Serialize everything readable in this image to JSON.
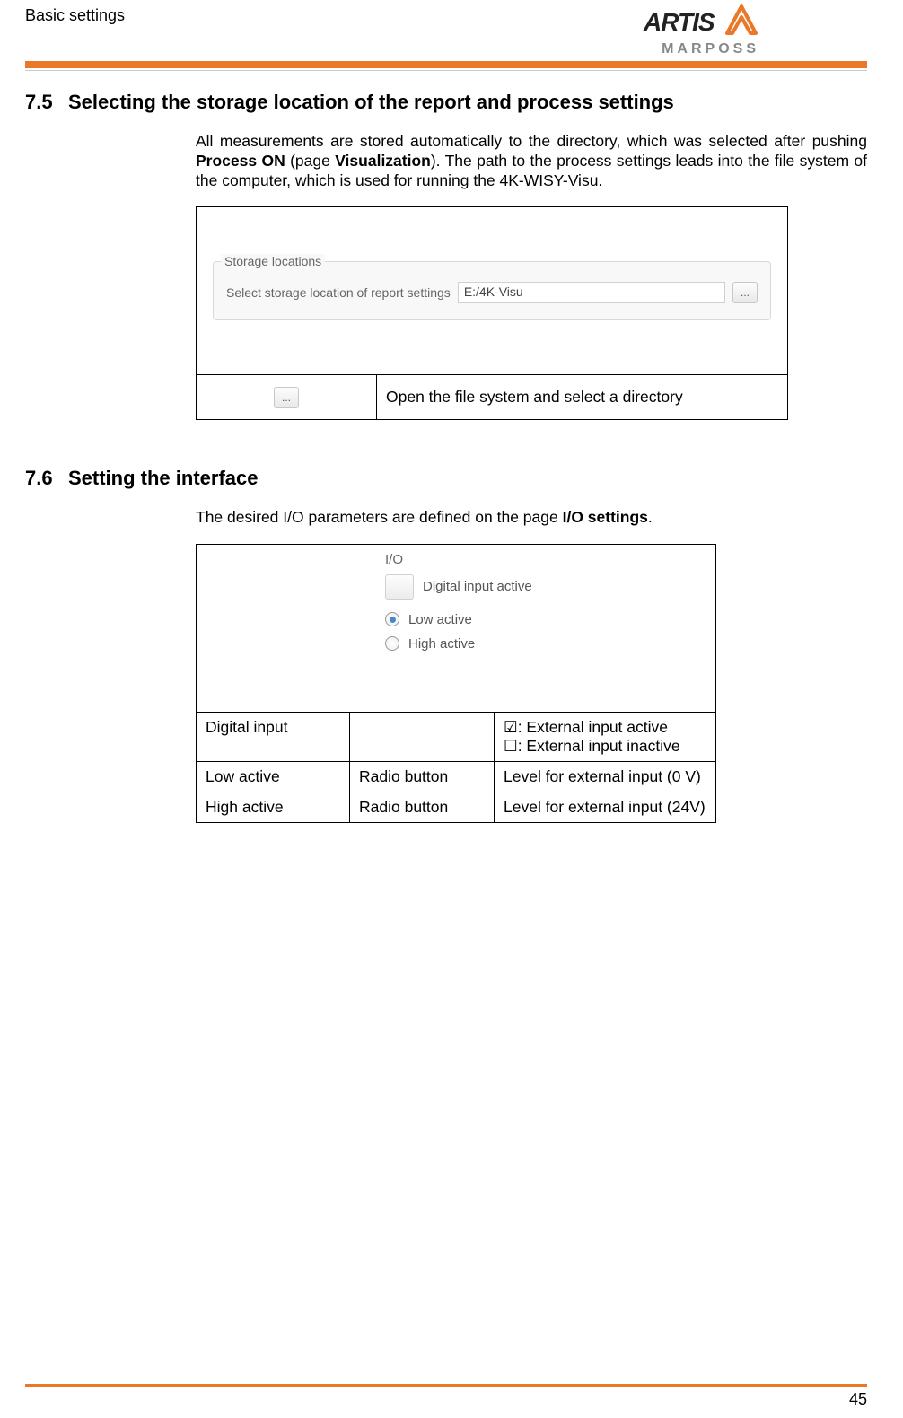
{
  "header": {
    "title": "Basic settings",
    "brand1": "ARTIS",
    "brand2": "MARPOSS"
  },
  "section75": {
    "number": "7.5",
    "title": "Selecting the storage location of the report and process settings",
    "para_pre": "All measurements are stored automatically to the directory, which was selected after pushing ",
    "bold1": "Process ON",
    "para_mid1": " (page ",
    "bold2": "Visualization",
    "para_post": "). The path to the process settings leads into the file system of the computer, which is used for running the 4K-WISY-Visu.",
    "storage": {
      "legend": "Storage locations",
      "label": "Select storage location of report settings",
      "value": "E:/4K-Visu",
      "browse": "..."
    },
    "browse_desc": "Open the file system and select a directory"
  },
  "section76": {
    "number": "7.6",
    "title": "Setting the interface",
    "para_pre": "The desired I/O parameters are defined on the page ",
    "bold1": "I/O settings",
    "para_post": ".",
    "io": {
      "header": "I/O",
      "digital_input": "Digital input active",
      "low": "Low active",
      "high": "High active"
    },
    "table": {
      "r1c1": "Digital input",
      "r1c2": "",
      "r1c3": "☑: External input active\n☐: External input inactive",
      "r2c1": "Low active",
      "r2c2": "Radio button",
      "r2c3": "Level for external input (0 V)",
      "r3c1": "High active",
      "r3c2": "Radio button",
      "r3c3": "Level for external input (24V)"
    }
  },
  "page_number": "45"
}
